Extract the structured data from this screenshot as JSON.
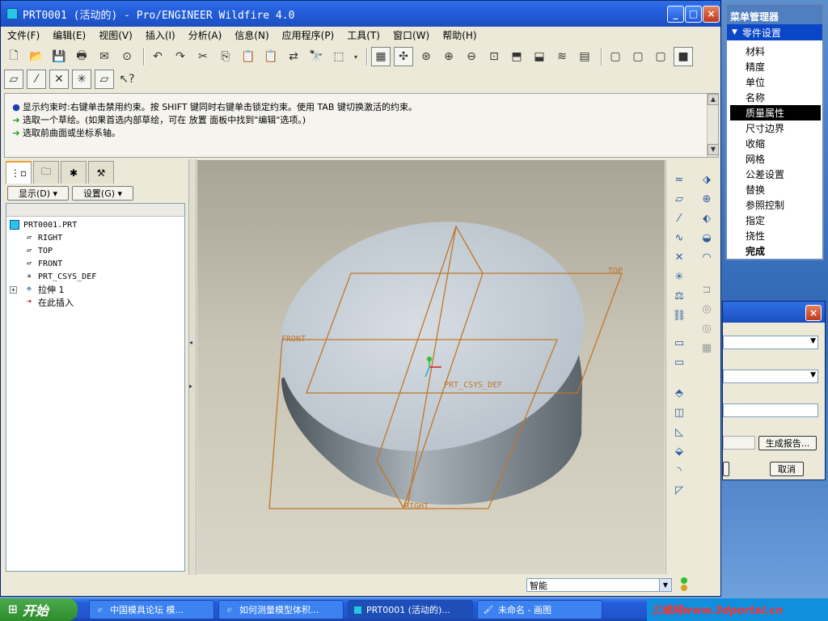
{
  "window": {
    "title": "PRT0001 (活动的) - Pro/ENGINEER Wildfire 4.0",
    "min": "_",
    "max": "□",
    "close": "×"
  },
  "menu": [
    "文件(F)",
    "编辑(E)",
    "视图(V)",
    "插入(I)",
    "分析(A)",
    "信息(N)",
    "应用程序(P)",
    "工具(T)",
    "窗口(W)",
    "帮助(H)"
  ],
  "messages": [
    {
      "icon": "●",
      "text": "显示约束时:右键单击禁用约束。按 SHIFT 键同时右键单击锁定约束。使用 TAB 键切换激活的约束。"
    },
    {
      "icon": "➔",
      "text": "选取一个草绘。(如果首选内部草绘，可在 放置 面板中找到\"编辑\"选项。)"
    },
    {
      "icon": "➔",
      "text": "选取前曲面或坐标系轴。"
    }
  ],
  "left_panel": {
    "display_btn": "显示(D) ▾",
    "settings_btn": "设置(G) ▾",
    "tree": [
      {
        "label": "PRT0001.PRT",
        "icon": "part-icon",
        "indent": 0
      },
      {
        "label": "RIGHT",
        "icon": "datum-plane-icon",
        "indent": 1
      },
      {
        "label": "TOP",
        "icon": "datum-plane-icon",
        "indent": 1
      },
      {
        "label": "FRONT",
        "icon": "datum-plane-icon",
        "indent": 1
      },
      {
        "label": "PRT_CSYS_DEF",
        "icon": "csys-icon",
        "indent": 1
      },
      {
        "label": "拉伸 1",
        "icon": "extrude-icon",
        "indent": 1
      },
      {
        "label": "在此插入",
        "icon": "insert-arrow-icon",
        "indent": 1
      }
    ]
  },
  "viewport": {
    "labels": {
      "top": "TOP",
      "front": "FRONT",
      "right": "RIGHT",
      "csys": "PRT_CSYS_DEF"
    },
    "colors": {
      "datum": "#c0772a",
      "solid_top": "#c3ccd4",
      "solid_side": "#7c858f"
    }
  },
  "status": {
    "filter": "智能"
  },
  "menu_manager": {
    "title": "菜单管理器",
    "submenu": "零件设置",
    "items": [
      "材料",
      "精度",
      "单位",
      "名称",
      "质量属性",
      "尺寸边界",
      "收缩",
      "网格",
      "公差设置",
      "替换",
      "参照控制",
      "指定",
      "挠性",
      "完成"
    ],
    "selected": "质量属性",
    "bold": "完成"
  },
  "dialog": {
    "report_btn": "生成报告...",
    "cancel_btn": "取消"
  },
  "taskbar": {
    "start": "开始",
    "tasks": [
      "中国模具论坛 模...",
      "如何测量模型体积...",
      "PRT0001 (活动的)...",
      "未命名 - 画图"
    ],
    "watermark": "三维网www.3dportal.cn"
  }
}
